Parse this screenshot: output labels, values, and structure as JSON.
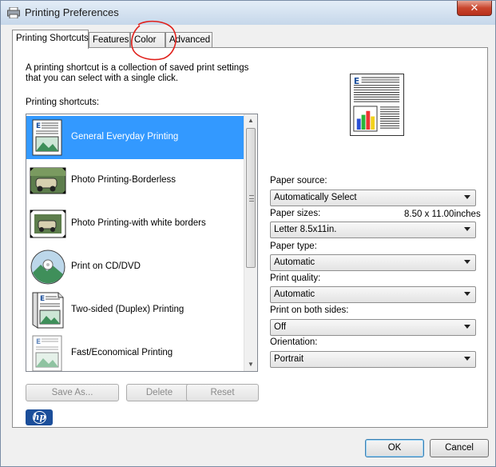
{
  "window": {
    "title": "Printing Preferences",
    "close_label": "✕"
  },
  "tabs": [
    {
      "label": "Printing Shortcuts",
      "active": true
    },
    {
      "label": "Features",
      "active": false
    },
    {
      "label": "Color",
      "active": false
    },
    {
      "label": "Advanced",
      "active": false
    }
  ],
  "description": "A printing shortcut is a collection of saved print settings that you can select with a single click.",
  "shortcuts_label": "Printing shortcuts:",
  "shortcuts": [
    {
      "label": "General Everyday Printing",
      "selected": true,
      "icon": "document-icon"
    },
    {
      "label": "Photo Printing-Borderless",
      "selected": false,
      "icon": "photo-borderless-icon"
    },
    {
      "label": "Photo Printing-with white borders",
      "selected": false,
      "icon": "photo-bordered-icon"
    },
    {
      "label": "Print on CD/DVD",
      "selected": false,
      "icon": "cd-icon"
    },
    {
      "label": "Two-sided (Duplex) Printing",
      "selected": false,
      "icon": "duplex-icon"
    },
    {
      "label": "Fast/Economical Printing",
      "selected": false,
      "icon": "economy-icon"
    }
  ],
  "list_buttons": {
    "save_as": "Save As...",
    "delete": "Delete",
    "reset": "Reset"
  },
  "settings": {
    "paper_source_label": "Paper source:",
    "paper_source_value": "Automatically Select",
    "paper_sizes_label": "Paper sizes:",
    "paper_size_readout": "8.50 x 11.00inches",
    "paper_sizes_value": "Letter 8.5x11in.",
    "paper_type_label": "Paper type:",
    "paper_type_value": "Automatic",
    "print_quality_label": "Print quality:",
    "print_quality_value": "Automatic",
    "both_sides_label": "Print on both sides:",
    "both_sides_value": "Off",
    "orientation_label": "Orientation:",
    "orientation_value": "Portrait"
  },
  "logo_text": "hp",
  "dialog_buttons": {
    "ok": "OK",
    "cancel": "Cancel"
  },
  "colors": {
    "selection": "#3399ff",
    "annotation": "#e0201b"
  }
}
